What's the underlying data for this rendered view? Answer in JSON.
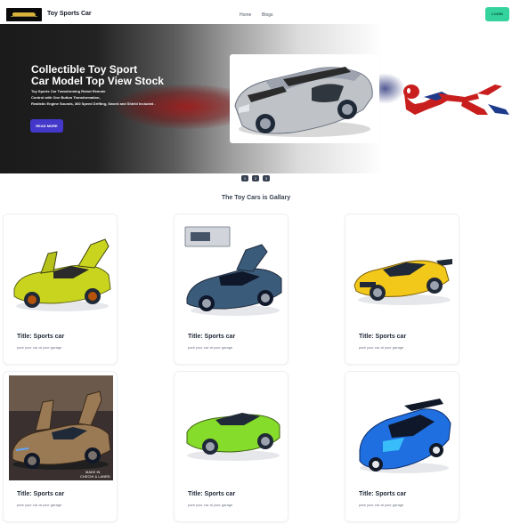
{
  "navbar": {
    "brand": "Toy Sports Car",
    "links": [
      "Home",
      "Blogs"
    ],
    "login_label": "LOGIN"
  },
  "hero": {
    "title_line1": "Collectible Toy Sport",
    "title_line2": "Car Model Top View Stock",
    "subtitle_line1": "Toy Sports Car Transforming Robot Remote",
    "subtitle_line2": "Control with One Button Transformation,",
    "subtitle_line3": "Realistic Engine Sounds, 360 Speed Drifting, Sword and Shield Included .",
    "button_label": "READ MORE"
  },
  "carousel_dots": [
    "1",
    "2",
    "3"
  ],
  "gallery": {
    "heading": "The Toy Cars is Gallary",
    "cards": [
      {
        "title": "Title: Sports car",
        "desc": "park your car at your garage",
        "car_color": "#c9d41e"
      },
      {
        "title": "Title: Sports car",
        "desc": "park your car at your garage",
        "car_color": "#3b5b7a"
      },
      {
        "title": "Title: Sports car",
        "desc": "park your car at your garage",
        "car_color": "#f2c81a"
      },
      {
        "title": "Title: Sports car",
        "desc": "park your car at your garage",
        "car_color": "#9a7a55"
      },
      {
        "title": "Title: Sports car",
        "desc": "park your car at your garage",
        "car_color": "#86dc2a"
      },
      {
        "title": "Title: Sports car",
        "desc": "park your car at your garage",
        "car_color": "#1f6fe0"
      }
    ]
  },
  "colors": {
    "login_bg": "#34d39e",
    "read_more_bg": "#4338ca"
  }
}
